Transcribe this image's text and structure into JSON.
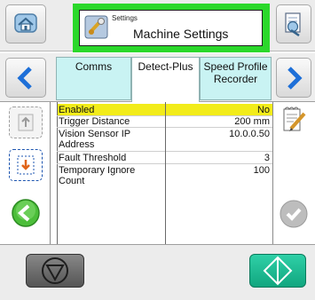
{
  "title_bar": {
    "small_label": "Settings",
    "title": "Machine Settings"
  },
  "tabs": [
    {
      "label": "Comms",
      "active": false
    },
    {
      "label": "Detect-Plus",
      "active": true
    },
    {
      "label": "Speed Profile Recorder",
      "active": false
    }
  ],
  "settings_rows": [
    {
      "label": "Enabled",
      "value": "No",
      "highlighted": true
    },
    {
      "label": "Trigger Distance",
      "value": "200 mm",
      "highlighted": false
    },
    {
      "label": "Vision Sensor IP Address",
      "value": "10.0.0.50",
      "highlighted": false
    },
    {
      "label": "Fault Threshold",
      "value": "3",
      "highlighted": false
    },
    {
      "label": "Temporary Ignore Count",
      "value": "100",
      "highlighted": false
    }
  ],
  "colors": {
    "title_frame": "#2bd82b",
    "tab_bg": "#c9f3f3",
    "highlight": "#f2ec1a",
    "nav_arrow": "#1d6fd8",
    "start_button": "#1cb890",
    "stop_button": "#6e6e6e"
  },
  "icons": {
    "home": "home-icon",
    "settings": "settings-icon",
    "export": "export-icon",
    "prev": "chevron-left-icon",
    "next": "chevron-right-icon",
    "upload": "upload-icon",
    "download": "download-icon",
    "back": "back-arrow-icon",
    "edit": "edit-icon",
    "confirm": "check-icon",
    "stop": "stop-icon",
    "start": "start-icon"
  }
}
